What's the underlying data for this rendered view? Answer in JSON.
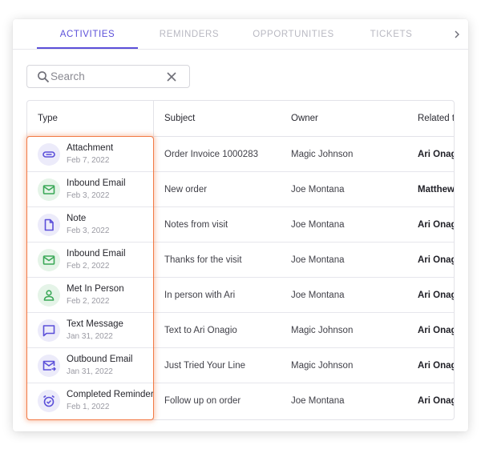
{
  "tabs": [
    {
      "label": "ACTIVITIES",
      "active": true
    },
    {
      "label": "REMINDERS",
      "active": false
    },
    {
      "label": "OPPORTUNITIES",
      "active": false
    },
    {
      "label": "TICKETS",
      "active": false
    }
  ],
  "search": {
    "placeholder": "Search",
    "value": ""
  },
  "table": {
    "headers": [
      "Type",
      "Subject",
      "Owner",
      "Related t"
    ],
    "rows": [
      {
        "type": "Attachment",
        "date": "Feb 7, 2022",
        "icon": "paperclip-icon",
        "icon_color": "purple",
        "subject": "Order Invoice 1000283",
        "owner": "Magic Johnson",
        "related": "Ari Onagio"
      },
      {
        "type": "Inbound Email",
        "date": "Feb 3, 2022",
        "icon": "envelope-icon",
        "icon_color": "green",
        "subject": "New order",
        "owner": "Joe Montana",
        "related": "Matthew"
      },
      {
        "type": "Note",
        "date": "Feb 3, 2022",
        "icon": "document-icon",
        "icon_color": "purple",
        "subject": "Notes from visit",
        "owner": "Joe Montana",
        "related": "Ari Onagio"
      },
      {
        "type": "Inbound Email",
        "date": "Feb 2, 2022",
        "icon": "envelope-icon",
        "icon_color": "green",
        "subject": "Thanks for the visit",
        "owner": "Joe Montana",
        "related": "Ari Onagio"
      },
      {
        "type": "Met In Person",
        "date": "Feb 2, 2022",
        "icon": "person-icon",
        "icon_color": "green",
        "subject": "In person with Ari",
        "owner": "Joe Montana",
        "related": "Ari Onagio"
      },
      {
        "type": "Text Message",
        "date": "Jan 31, 2022",
        "icon": "chat-bubble-icon",
        "icon_color": "purple",
        "subject": "Text to Ari Onagio",
        "owner": "Magic Johnson",
        "related": "Ari Onagio"
      },
      {
        "type": "Outbound Email",
        "date": "Jan 31, 2022",
        "icon": "outbound-mail-icon",
        "icon_color": "purple",
        "subject": "Just Tried Your Line",
        "owner": "Magic Johnson",
        "related": "Ari Onagio"
      },
      {
        "type": "Completed Reminder",
        "date": "Feb 1, 2022",
        "icon": "alarm-clock-icon",
        "icon_color": "purple",
        "subject": "Follow up on order",
        "owner": "Joe Montana",
        "related": "Ari Onagio"
      }
    ]
  },
  "colors": {
    "accent": "#5b4fd9",
    "green": "#3aa857",
    "highlight": "#f27a45"
  }
}
